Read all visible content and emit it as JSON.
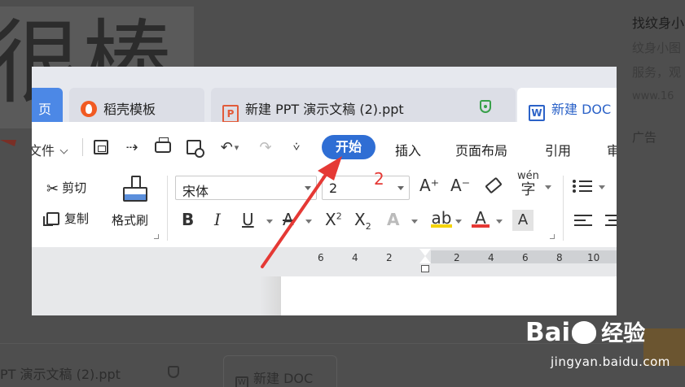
{
  "background": {
    "big_glyphs": "很棒",
    "right_panel": {
      "title": "找纹身小",
      "line1": "纹身小图",
      "line2": "服务，观",
      "line3": "www.16",
      "ad_label": "广告"
    },
    "bottom_tab1": "PT 演示文稿 (2).ppt",
    "bottom_tab2": "新建 DOC"
  },
  "watermark": {
    "logo_left": "Bai",
    "logo_right": "经验",
    "paw_char": "du",
    "url": "jingyan.baidu.com"
  },
  "tabs": [
    {
      "label": "页"
    },
    {
      "label": "稻壳模板"
    },
    {
      "label": "新建 PPT 演示文稿 (2).ppt"
    },
    {
      "label": "新建 DOC"
    }
  ],
  "tab_icons": {
    "ppt_letter": "P",
    "doc_letter": "W"
  },
  "menu": {
    "file": "文件",
    "start": "开始",
    "insert": "插入",
    "layout": "页面布局",
    "reference": "引用",
    "review": "审"
  },
  "quick_access": {
    "output_glyph": "⇢",
    "undo_glyph": "↶",
    "undo_dd": "▾",
    "redo_glyph": "↷",
    "more_glyph": "⩒"
  },
  "ribbon": {
    "cut": "剪切",
    "copy": "复制",
    "format_painter": "格式刷",
    "font_name": "宋体",
    "font_size": "2",
    "grow": "A⁺",
    "shrink": "A⁻",
    "pinyin_top": "wén",
    "pinyin_bottom": "字",
    "bold": "B",
    "italic": "I",
    "underline": "U",
    "strike": "A",
    "sup_base": "X",
    "sup_mark": "2",
    "sub_base": "X",
    "sub_mark": "2",
    "effect": "A",
    "highlight": "ab",
    "font_color": "A",
    "shading": "A"
  },
  "ruler": {
    "ticks": [
      "6",
      "4",
      "2",
      "2",
      "4",
      "6",
      "8",
      "10"
    ]
  },
  "annotation": {
    "number": "2",
    "color": "#e53935"
  },
  "colors": {
    "accent_blue": "#2f6ed4",
    "home_tab": "#4c88e6",
    "daoke_orange": "#f15a22",
    "ppt_red": "#e25b3a",
    "shield_green": "#38a04a",
    "highlight_yellow": "#f5d400"
  },
  "icons": [
    "scissors-icon",
    "copy-icon",
    "format-painter-icon",
    "save-icon",
    "print-icon",
    "print-preview-icon",
    "undo-icon",
    "redo-icon",
    "eraser-icon",
    "bullets-icon",
    "shield-icon"
  ]
}
